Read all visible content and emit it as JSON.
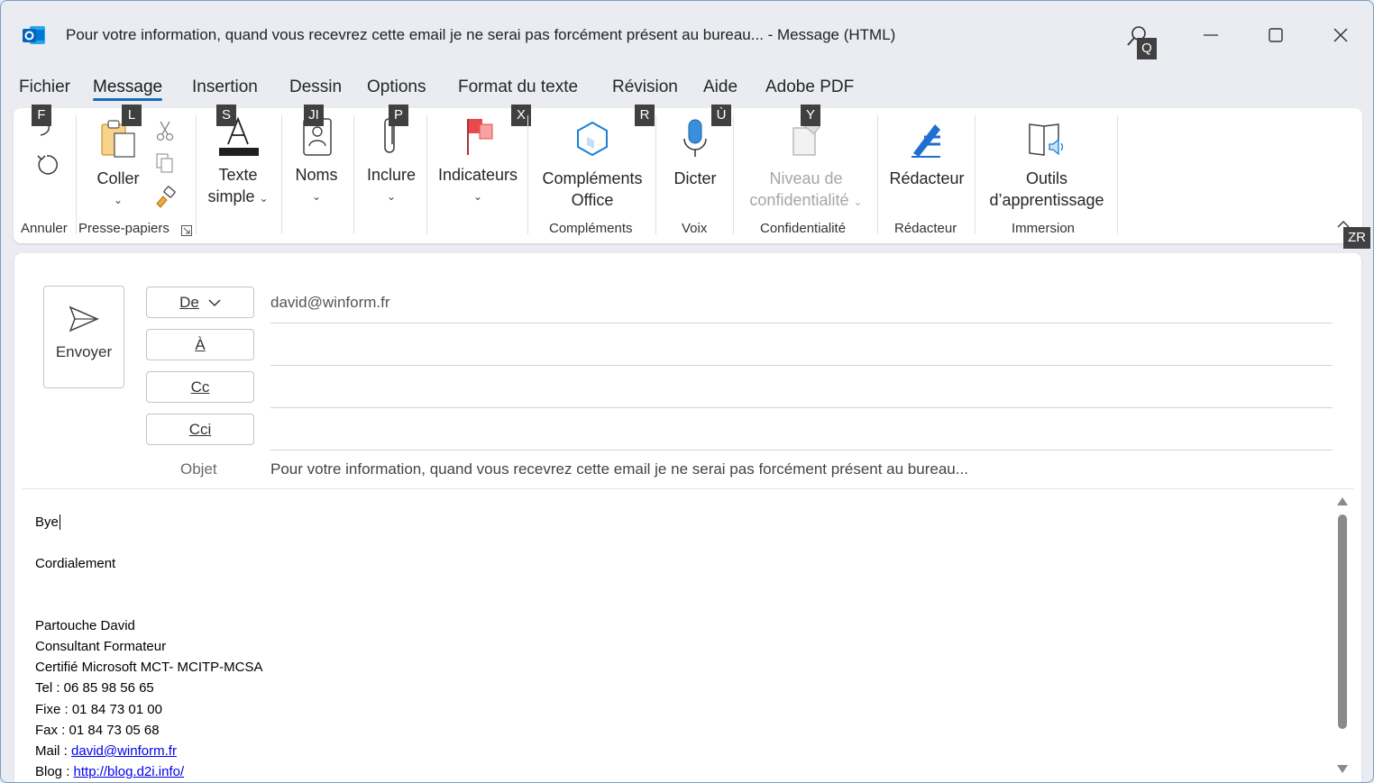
{
  "window": {
    "title": "Pour votre information, quand vous recevrez cette email je ne serai pas forcément présent au bureau...  -  Message (HTML)"
  },
  "keytips": {
    "search": "Q",
    "fichier": "F",
    "message": "L",
    "insertion": "S",
    "dessin": "JI",
    "options": "P",
    "format": "X",
    "revision": "R",
    "aide": "Ù",
    "adobe": "Y",
    "collapse": "ZR"
  },
  "tabs": [
    "Fichier",
    "Message",
    "Insertion",
    "Dessin",
    "Options",
    "Format du texte",
    "Révision",
    "Aide",
    "Adobe PDF"
  ],
  "active_tab": "Message",
  "ribbon": {
    "undo_group": "Annuler",
    "clipboard_group": "Presse-papiers",
    "paste": "Coller",
    "text_line1": "Texte",
    "text_line2": "simple",
    "names": "Noms",
    "include": "Inclure",
    "flags": "Indicateurs",
    "addins_line1": "Compléments",
    "addins_line2": "Office",
    "addins_group": "Compléments",
    "dictate": "Dicter",
    "voice_group": "Voix",
    "sensitivity_line1": "Niveau de",
    "sensitivity_line2": "confidentialité",
    "sensitivity_group": "Confidentialité",
    "editor": "Rédacteur",
    "editor_group": "Rédacteur",
    "learning_line1": "Outils",
    "learning_line2": "d’apprentissage",
    "immersion_group": "Immersion"
  },
  "compose": {
    "send": "Envoyer",
    "from_label": "De",
    "from_value": "david@winform.fr",
    "to_label": "À",
    "cc_label": "Cc",
    "bcc_label": "Cci",
    "subject_label": "Objet",
    "subject_value": "Pour votre information, quand vous recevrez cette email je ne serai pas forcément présent au bureau..."
  },
  "body": {
    "line1": "Bye",
    "line2": "Cordialement",
    "sig_name": "Partouche David",
    "sig_title": "Consultant Formateur",
    "sig_cert": "Certifié Microsoft MCT- MCITP-MCSA",
    "sig_tel": "Tel :  06 85 98 56 65",
    "sig_fixe": "Fixe : 01 84 73 01 00",
    "sig_fax": "Fax : 01 84 73 05 68",
    "sig_mail_label": "Mail  : ",
    "sig_mail_link": "david@winform.fr",
    "sig_blog_label": "Blog : ",
    "sig_blog_link": "http://blog.d2i.info/"
  },
  "colors": {
    "accent": "#0f6cbd",
    "outlook_blue": "#0364b8",
    "flag_red": "#e8494a",
    "link": "#0000ee"
  },
  "icons": [
    "outlook-icon",
    "search-icon",
    "minimize-icon",
    "maximize-icon",
    "close-icon",
    "redo-icon",
    "undo-icon",
    "paste-icon",
    "cut-icon",
    "copy-icon",
    "format-painter-icon",
    "text-icon",
    "names-icon",
    "attach-icon",
    "flag-icon",
    "addins-icon",
    "mic-icon",
    "sensitivity-icon",
    "editor-icon",
    "learning-icon",
    "send-icon",
    "chevron-down-icon"
  ]
}
